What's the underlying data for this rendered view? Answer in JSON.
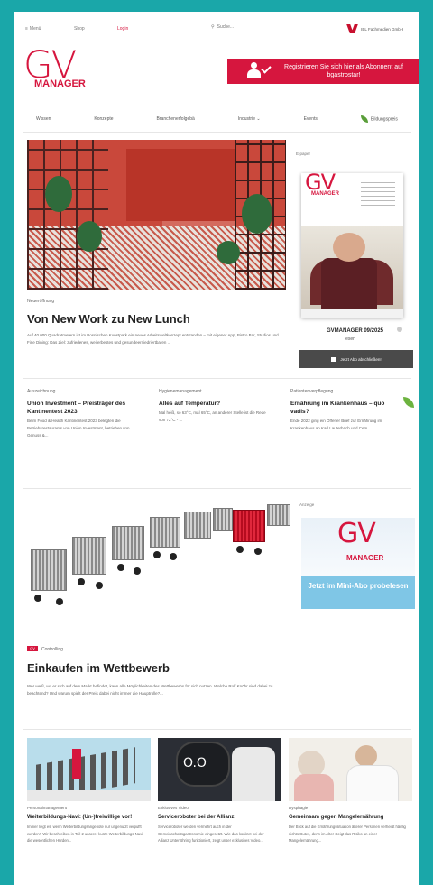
{
  "topbar": {
    "menu": "Menü",
    "shop": "Shop",
    "login": "Login",
    "search": "Suche...",
    "brand": "IBL Fachmedien GmbH"
  },
  "logo": {
    "gv": "GV",
    "manager": "MANAGER"
  },
  "register_banner": {
    "text": "Registrieren Sie sich hier als Abonnent auf bgastrostar!"
  },
  "nav": {
    "items": [
      "Wissen",
      "Konzepte",
      "Branchenerfolgebä",
      "Industrie",
      "Events",
      "Bildungspreis"
    ],
    "dropdown_index": 3
  },
  "hero": {
    "kicker": "Neueröffnung",
    "title": "Von New Work zu New Lunch",
    "teaser": "Auf 40.000 Quadratmetern ist im Bosnischen Kunstpark ein neues Arbeitsweltkonzept entstanden – mit eigener App, Bistro Bar, Studios und Fine Dining: Das Ziel: zufriedenes, weiterbestes und gesundeerniedriertbaren ..."
  },
  "sidebar": {
    "label": "E-paper",
    "issue": "GVMANAGER 09/2025",
    "read": "lesen",
    "abo_button": "Jetzt Abo abschließen!"
  },
  "row3": [
    {
      "cat": "Auszeichnung",
      "title": "Union Investment – Preisträger des Kantinentest 2023",
      "body": "Beim Food & Health Kantinentest 2023 belegten die Betriebsrestaurants von Union Investment, betrieben von Genuss &..."
    },
    {
      "cat": "Hygienemanagement",
      "title": "Alles auf Temperatur?",
      "body": "Mal heiß, so 63°C, mal 65°C, an anderer Stelle ist die Rede von 72°C - ..."
    },
    {
      "cat": "Patientenverpflegung",
      "title": "Ernährung im Krankenhaus – quo vadis?",
      "body": "Ende 2022 ging ein Offener Brief zur Ernährung im Krankenhaus an Karl Lauterbach und Cem..."
    }
  ],
  "carts_article": {
    "tag": "GV",
    "kicker": "Controlling",
    "title": "Einkaufen im Wettbewerb",
    "teaser": "Wer weiß, wo er sich auf dem Markt befindet, kann alle Möglichkeiten des Wettbewerbs für sich nutzen. Welche Rolf Knöhr sind dabei zu beachtend? Und warum spielt der Preis dabei nicht immer die Hauptrolle?..."
  },
  "ad": {
    "label": "Anzeige",
    "gv": "GV",
    "manager": "MANAGER",
    "cta": "Jetzt im Mini-Abo probelesen"
  },
  "bottom": [
    {
      "cat": "Personalmanagement",
      "title": "Weiterbildungs-Navi: (Un-)freiwillige vor!",
      "body": "Immer liegt es, wenn Weiterbildungsangebote nur ungenutzt verpufft werden? Wir beschreiben in Teil 2 unserer kurze Weiterbildungs-Navi die wesentlichen Hürden..."
    },
    {
      "cat": "Exklusives Video",
      "title": "Serviceroboter bei der Allianz",
      "body": "Serviceroboter werden vermehrt auch in der Gemeinschaftsgastronomie eingesetzt. Wie das konkret bei der Allianz Unterföhring funktioniert, zeigt unser exklusives Video..."
    },
    {
      "cat": "Dysphagie",
      "title": "Gemeinsam gegen Mangelernährung",
      "body": "Der Blick auf die Ernährungssituation älterer Personen verheißt häufig nichts Gutes, denn im Alter steigt das Risiko an einer Mangelernährung..."
    }
  ],
  "colors": {
    "brand_red": "#d6163e",
    "teal_border": "#1aa7a9",
    "ad_blue": "#7fc6e6"
  }
}
